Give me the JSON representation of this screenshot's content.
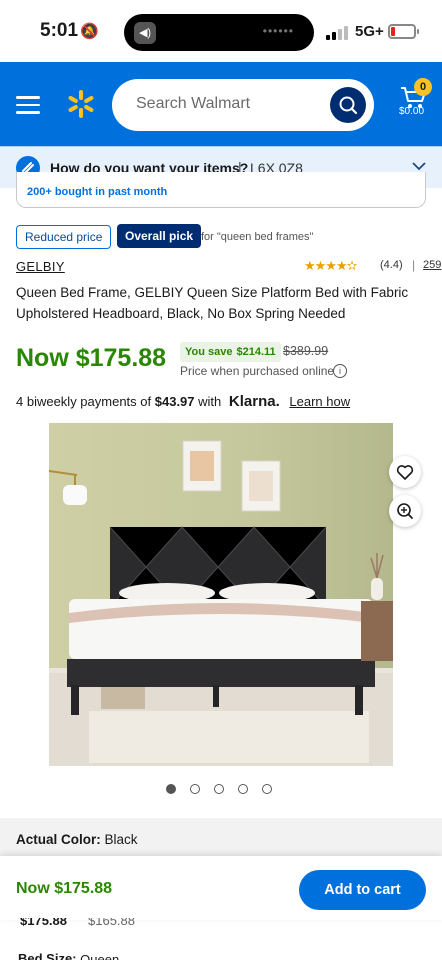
{
  "status_bar": {
    "time": "5:01",
    "network": "5G+"
  },
  "header": {
    "search_placeholder": "Search Walmart",
    "cart_count": "0",
    "cart_total": "$0.00",
    "brand_color": "#0071dc",
    "spark_color": "#ffc220"
  },
  "delivery": {
    "question": "How do you want your items?",
    "separator": "|",
    "postal_code": "L6X 0Z8"
  },
  "bought": "200+ bought in past month",
  "tags": {
    "reduced": "Reduced price",
    "overall_pick": "Overall pick",
    "for_text": "for \"queen bed frames\""
  },
  "product": {
    "brand": "GELBIY",
    "stars": "★★★★✫",
    "rating": "(4.4)",
    "rating_divider": "|",
    "review_count": "259",
    "title": "Queen Bed Frame, GELBIY Queen Size Platform Bed with Fabric Upholstered Headboard, Black, No Box Spring Needed",
    "now_price": "Now $175.88",
    "you_save_label": "You save",
    "you_save_amount": "$214.11",
    "was_price": "$389.99",
    "price_note": "Price when purchased online",
    "klarna_prefix": "4 biweekly payments of",
    "klarna_amount": "$43.97",
    "klarna_with": "with",
    "klarna_logo": "Klarna.",
    "klarna_learn": "Learn how",
    "image_count": 5,
    "active_image": 1
  },
  "color_section": {
    "label": "Actual Color:",
    "value": "Black"
  },
  "bottom_bar": {
    "now_price": "Now $175.88",
    "add_to_cart": "Add to cart"
  },
  "peek": {
    "price_a": "$175.88",
    "price_b": "$165.88",
    "size_label": "Bed Size:",
    "size_value": "Queen"
  },
  "colors": {
    "price_green": "#2a8703",
    "dark_navy": "#002d72"
  }
}
